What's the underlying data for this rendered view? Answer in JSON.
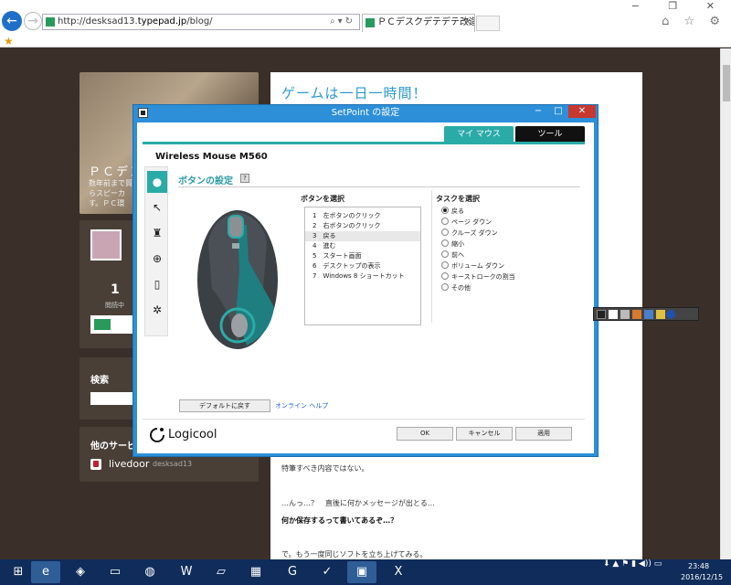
{
  "browser": {
    "url_prefix": "http://desksad13.",
    "url_host": "typepad.jp",
    "url_path": "/blog/",
    "tab_title": "ＰＣデスクデテデテ改造記",
    "window_controls": "−  ❐  ✕",
    "right_icons": "⌂ ☆ ⚙"
  },
  "blog": {
    "name": "ＰＣデン",
    "desc_line1": "数年前まで貿",
    "desc_line2": "らスピーカ",
    "desc_line3": "す。ＰＣ環",
    "visit_count": "1",
    "visit_label": "閲読中",
    "search_title": "検索",
    "services_title": "他のサービ",
    "service_name": "livedoor",
    "service_user": "desksad13",
    "post_title": "ゲームは一日一時間！",
    "para1": "特筆すべき内容ではない。",
    "para2": "…んっ…？　直後に何かメッセージが出とる…",
    "para3": "何か保存するって書いてあるぞ…？",
    "para4": "で。もう一度同じソフトを立ち上げてみる。"
  },
  "dialog": {
    "title": "SetPoint の設定",
    "tab_mymouse": "マイ マウス",
    "tab_tools": "ツール",
    "device_name": "Wireless Mouse M560",
    "section_title": "ボタンの設定",
    "button_select_label": "ボタンを選択",
    "task_select_label": "タスクを選択",
    "buttons": [
      "1　左ボタンのクリック",
      "2　右ボタンのクリック",
      "3　戻る",
      "4　進む",
      "5　スタート画面",
      "6　デスクトップの表示",
      "7　Windows 8 ショートカット"
    ],
    "tasks": [
      "戻る",
      "ページ ダウン",
      "クルーズ ダウン",
      "縮小",
      "前へ",
      "ボリューム ダウン",
      "キーストロークの割当",
      "その他"
    ],
    "selected_task_index": 0,
    "default_button": "デフォルトに戻す",
    "online_help": "オンライン ヘルプ",
    "logo": "Logicool",
    "ok": "OK",
    "cancel": "キャンセル",
    "apply": "適用",
    "help_symbol": "?"
  },
  "taskbar": {
    "time": "23:48",
    "date": "2016/12/15"
  }
}
